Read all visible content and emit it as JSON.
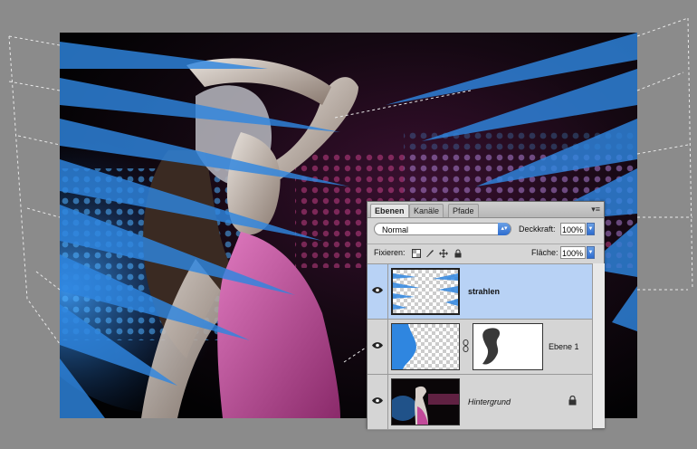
{
  "layers_panel": {
    "tabs": [
      "Ebenen",
      "Kanäle",
      "Pfade"
    ],
    "active_tab_index": 0,
    "blend_mode": "Normal",
    "opacity_label": "Deckkraft:",
    "opacity_value": "100%",
    "lock_label": "Fixieren:",
    "fill_label": "Fläche:",
    "fill_value": "100%",
    "layers": [
      {
        "name": "strahlen",
        "selected": true,
        "visible": true,
        "style": "bold"
      },
      {
        "name": "Ebene 1",
        "selected": false,
        "visible": true,
        "style": "normal",
        "has_mask": true
      },
      {
        "name": "Hintergrund",
        "selected": false,
        "visible": true,
        "style": "italic",
        "locked": true
      }
    ]
  },
  "icons": {
    "panel_menu": "panel-menu-icon",
    "visibility": "eye-icon",
    "link": "chain-link-icon",
    "lock": "lock-icon"
  },
  "colors": {
    "selection_highlight": "#b8d2f5",
    "ray_blue": "#2f86e0",
    "dress_pink": "#c24a9a"
  }
}
